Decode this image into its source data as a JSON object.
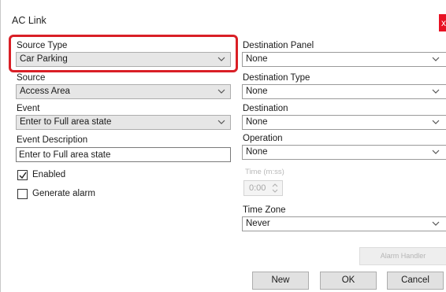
{
  "window": {
    "title": "AC Link",
    "close_label": "x"
  },
  "source_type": {
    "label": "Source Type",
    "value": "Car Parking"
  },
  "source": {
    "label": "Source",
    "value": "Access Area"
  },
  "event": {
    "label": "Event",
    "value": "Enter to Full area state"
  },
  "event_description": {
    "label": "Event Description",
    "value": "Enter to Full area state"
  },
  "enabled": {
    "label": "Enabled",
    "checked": true
  },
  "generate_alarm": {
    "label": "Generate alarm",
    "checked": false
  },
  "destination_panel": {
    "label": "Destination Panel",
    "value": "None"
  },
  "destination_type": {
    "label": "Destination Type",
    "value": "None"
  },
  "destination": {
    "label": "Destination",
    "value": "None"
  },
  "operation": {
    "label": "Operation",
    "value": "None"
  },
  "time": {
    "label": "Time (m:ss)",
    "value": "0:00"
  },
  "time_zone": {
    "label": "Time Zone",
    "value": "Never"
  },
  "buttons": {
    "alarm_handler": "Alarm Handler",
    "new": "New",
    "ok": "OK",
    "cancel": "Cancel"
  },
  "colors": {
    "highlight": "#d91f26",
    "close": "#e81123"
  },
  "icons": {
    "dropdown": "chevron-down-icon",
    "check": "checkmark-icon",
    "spin": "spin-arrows-icon"
  }
}
